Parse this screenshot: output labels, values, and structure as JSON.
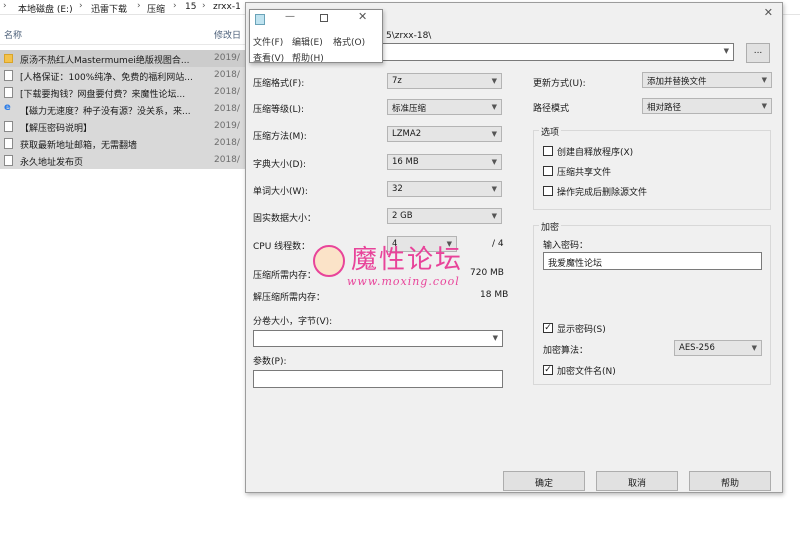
{
  "explorer": {
    "breadcrumb": [
      "本地磁盘 (E:)",
      "迅雷下载",
      "压缩",
      "15",
      "zrxx-1"
    ],
    "column_name": "名称",
    "column_date": "修改日",
    "files": [
      {
        "name": "原汤不热红人Mastermumei绝版视图合...",
        "date": "2019/",
        "icon": "folder-icon"
      },
      {
        "name": "[人格保证：100%纯净、免费的福利网站...",
        "date": "2018/",
        "icon": "file-icon"
      },
      {
        "name": "[下载要掏钱？网盘要付费？来魔性论坛...",
        "date": "2018/",
        "icon": "file-icon"
      },
      {
        "name": "【磁力无速度？种子没有源？没关系，来...",
        "date": "2018/",
        "icon": "ie-icon"
      },
      {
        "name": "【解压密码说明】",
        "date": "2019/",
        "icon": "file-icon"
      },
      {
        "name": "获取最新地址邮箱，无需翻墙",
        "date": "2018/",
        "icon": "file-icon"
      },
      {
        "name": "永久地址发布页",
        "date": "2018/",
        "icon": "file-icon"
      }
    ]
  },
  "mini_window": {
    "menus": [
      "文件(F)",
      "编辑(E)",
      "格式(O)",
      "查看(V)",
      "帮助(H)"
    ]
  },
  "dialog": {
    "archive_path_partial": "5\\zrxx-18\\",
    "browse_label": "...",
    "left": {
      "format_label": "压缩格式(F):",
      "format_value": "7z",
      "level_label": "压缩等级(L):",
      "level_value": "标准压缩",
      "method_label": "压缩方法(M):",
      "method_value": "LZMA2",
      "dict_label": "字典大小(D):",
      "dict_value": "16 MB",
      "word_label": "单词大小(W):",
      "word_value": "32",
      "solid_label": "固实数据大小：",
      "solid_value": "2 GB",
      "threads_label": "CPU 线程数：",
      "threads_value": "4",
      "threads_total": "/ 4",
      "mem_comp_label": "压缩所需内存：",
      "mem_comp_value": "720 MB",
      "mem_decomp_label": "解压缩所需内存：",
      "mem_decomp_value": "18 MB",
      "split_label": "分卷大小，字节(V):",
      "split_value": "",
      "params_label": "参数(P):",
      "params_value": ""
    },
    "right": {
      "update_label": "更新方式(U):",
      "update_value": "添加并替换文件",
      "pathmode_label": "路径模式",
      "pathmode_value": "相对路径",
      "options_title": "选项",
      "opt_sfx": "创建自释放程序(X)",
      "opt_shared": "压缩共享文件",
      "opt_delete": "操作完成后删除源文件",
      "enc_title": "加密",
      "pwd_label": "输入密码：",
      "pwd_value": "我爱魔性论坛",
      "show_pwd": "显示密码(S)",
      "enc_method_label": "加密算法：",
      "enc_method_value": "AES-256",
      "enc_names": "加密文件名(N)"
    },
    "buttons": {
      "ok": "确定",
      "cancel": "取消",
      "help": "帮助"
    },
    "close_glyph": "✕"
  },
  "watermark": {
    "cn": "魔性论坛",
    "url": "www.moxing.cool"
  },
  "colors": {
    "selection": "#cccccc",
    "dialog_bg": "#f0f0f0",
    "watermark": "#e8449a"
  }
}
